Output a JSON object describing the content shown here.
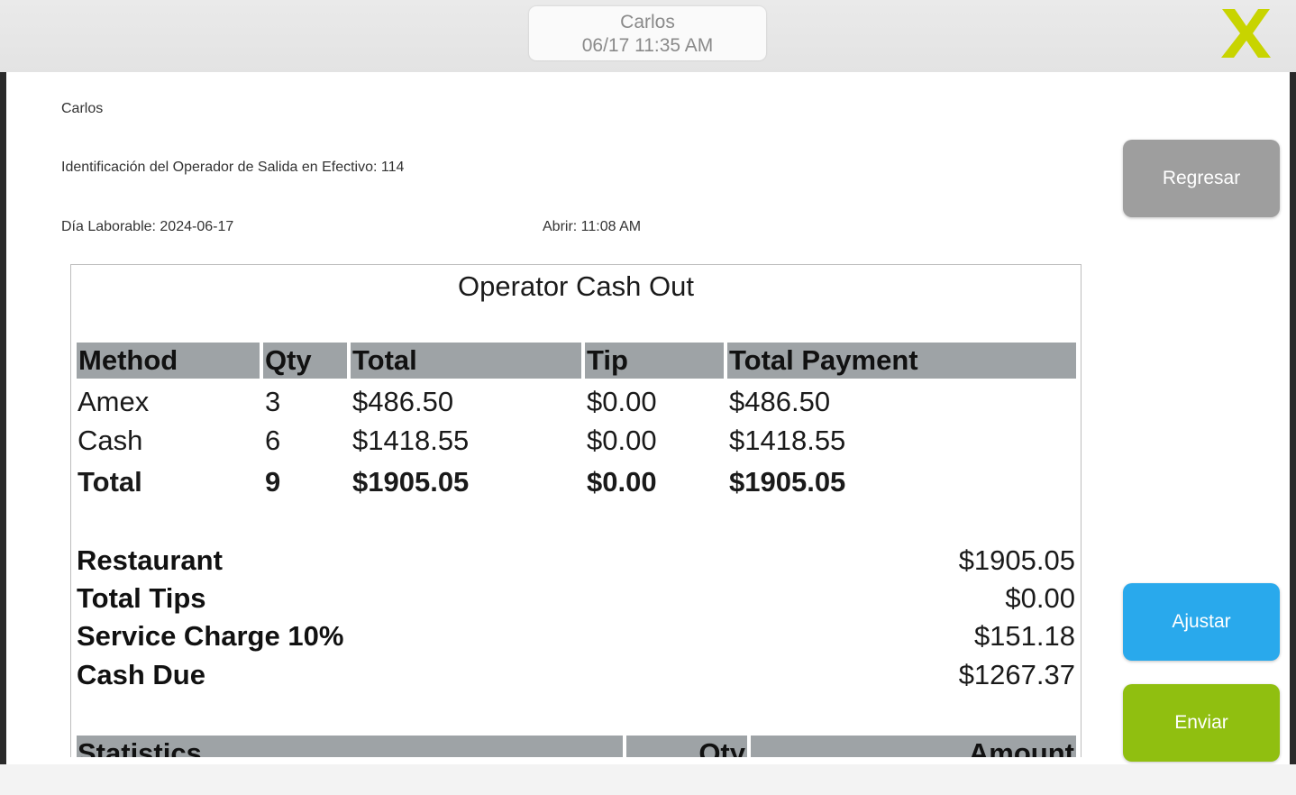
{
  "header": {
    "operator_name": "Carlos",
    "datetime": "06/17 11:35 AM"
  },
  "info": {
    "operator_name": "Carlos",
    "operator_id_line": "Identificación del Operador de Salida en Efectivo: 114",
    "business_day": "Día Laborable: 2024-06-17",
    "open_time": "Abrir: 11:08 AM"
  },
  "buttons": {
    "back": "Regresar",
    "adjust": "Ajustar",
    "send": "Enviar"
  },
  "receipt": {
    "title": "Operator Cash Out",
    "columns": [
      "Method",
      "Qty",
      "Total",
      "Tip",
      "Total Payment"
    ],
    "rows": [
      [
        "Amex",
        "3",
        "$486.50",
        "$0.00",
        "$486.50"
      ],
      [
        "Cash",
        "6",
        "$1418.55",
        "$0.00",
        "$1418.55"
      ]
    ],
    "total_row": [
      "Total",
      "9",
      "$1905.05",
      "$0.00",
      "$1905.05"
    ],
    "summary": [
      {
        "label": "Restaurant",
        "value": "$1905.05"
      },
      {
        "label": "Total Tips",
        "value": "$0.00"
      },
      {
        "label": "Service Charge 10%",
        "value": "$151.18"
      },
      {
        "label": "Cash Due",
        "value": "$1267.37"
      }
    ],
    "stats_columns": [
      "Statistics",
      "Qty",
      "Amount"
    ]
  },
  "colors": {
    "back_button": "#9e9e9e",
    "adjust_button": "#29a9ec",
    "send_button": "#90bf10",
    "close_icon": "#c8d400",
    "table_header": "#9ea3a6"
  },
  "icons": {
    "close": "close-x-icon"
  }
}
